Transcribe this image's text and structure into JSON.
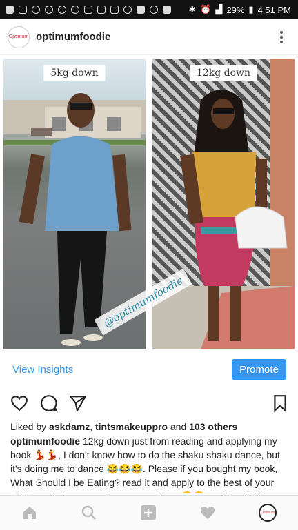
{
  "status_bar": {
    "battery": "29%",
    "time": "4:51 PM"
  },
  "header": {
    "avatar_text": "Optimum",
    "username": "optimumfoodie"
  },
  "post": {
    "left_label": "5kg down",
    "right_label": "12kg down",
    "watermark": "@optimumfoodie"
  },
  "insights": {
    "view_insights": "View Insights",
    "promote": "Promote"
  },
  "likes": {
    "prefix": "Liked by ",
    "user1": "askdamz",
    "sep": ", ",
    "user2": "tintsmakeuppro",
    "and": " and ",
    "others": "103 others"
  },
  "caption": {
    "username": "optimumfoodie",
    "text": " 12kg down just from reading and applying my book 💃💃, I don't know how to do the shaku shaku dance, but it's doing me to dance 😂😂😂. Please if you bought my book, What Should I be Eating? read it and apply to the best of your ability and please send us your reviews 😂😂, we'll really like"
  },
  "bottom_nav": {
    "icons": [
      "home-icon",
      "search-icon",
      "add-icon",
      "heart-icon",
      "profile-icon"
    ]
  },
  "colors": {
    "accent": "#3897f0",
    "heart_active": "#333333"
  }
}
